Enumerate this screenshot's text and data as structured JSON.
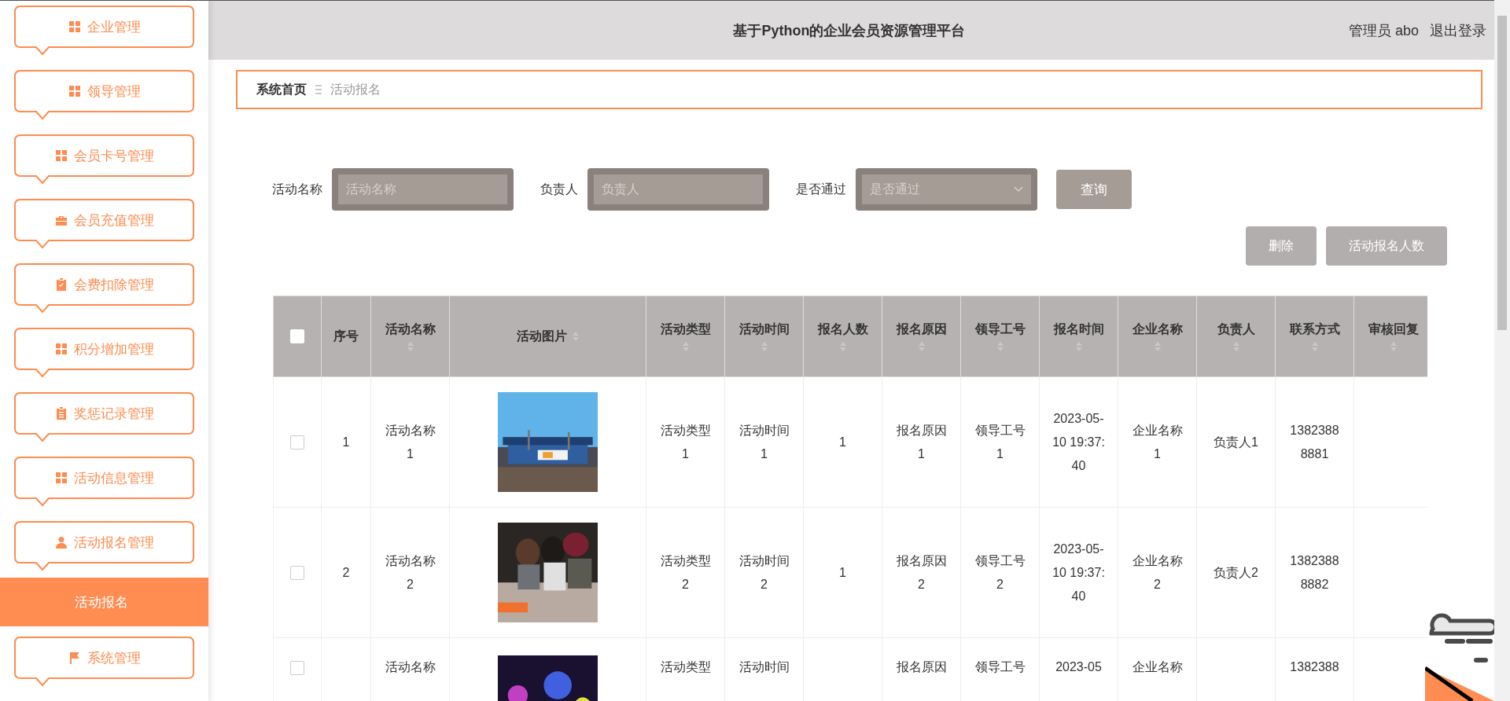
{
  "sidebar": {
    "items": [
      {
        "label": "企业管理",
        "kind": "grid"
      },
      {
        "label": "领导管理",
        "kind": "grid"
      },
      {
        "label": "会员卡号管理",
        "kind": "grid"
      },
      {
        "label": "会员充值管理",
        "kind": "briefcase"
      },
      {
        "label": "会费扣除管理",
        "kind": "clipboard-check"
      },
      {
        "label": "积分增加管理",
        "kind": "grid"
      },
      {
        "label": "奖惩记录管理",
        "kind": "clipboard"
      },
      {
        "label": "活动信息管理",
        "kind": "grid"
      },
      {
        "label": "活动报名管理",
        "kind": "person",
        "children": [
          {
            "label": "活动报名",
            "selected": true
          }
        ]
      },
      {
        "label": "系统管理",
        "kind": "flag"
      }
    ]
  },
  "header": {
    "title": "基于Python的企业会员资源管理平台",
    "user": "管理员 abo",
    "logout": "退出登录"
  },
  "breadcrumb": [
    "系统首页",
    "活动报名"
  ],
  "filters": [
    {
      "kind": "input",
      "label": "活动名称",
      "placeholder": "活动名称"
    },
    {
      "kind": "input",
      "label": "负责人",
      "placeholder": "负责人"
    },
    {
      "kind": "select",
      "label": "是否通过",
      "placeholder": "是否通过"
    }
  ],
  "search_button": "查询",
  "actions": [
    "删除",
    "活动报名人数"
  ],
  "table": {
    "select_all": {
      "checked": false
    },
    "columns": [
      {
        "label": "序号",
        "sortable": false
      },
      {
        "label": "活动名称",
        "sortable": true
      },
      {
        "label": "活动图片",
        "sortable": true
      },
      {
        "label": "活动类型",
        "sortable": true
      },
      {
        "label": "活动时间",
        "sortable": true
      },
      {
        "label": "报名人数",
        "sortable": true
      },
      {
        "label": "报名原因",
        "sortable": true
      },
      {
        "label": "领导工号",
        "sortable": true
      },
      {
        "label": "报名时间",
        "sortable": true
      },
      {
        "label": "企业名称",
        "sortable": true
      },
      {
        "label": "负责人",
        "sortable": true
      },
      {
        "label": "联系方式",
        "sortable": true
      },
      {
        "label": "审核回复",
        "sortable": true
      }
    ],
    "rows": [
      {
        "checked": false,
        "cells": [
          "1",
          "活动名称1",
          {
            "kind": "picture"
          },
          "活动类型1",
          "活动时间1",
          "1",
          "报名原因1",
          "领导工号1",
          "2023-05-10 19:37:40",
          "企业名称1",
          "负责人1",
          "13823888881",
          ""
        ]
      },
      {
        "checked": false,
        "cells": [
          "2",
          "活动名称2",
          {
            "kind": "picture"
          },
          "活动类型2",
          "活动时间2",
          "1",
          "报名原因2",
          "领导工号2",
          "2023-05-10 19:37:40",
          "企业名称2",
          "负责人2",
          "13823888882",
          ""
        ]
      },
      {
        "checked": false,
        "cells": [
          "",
          "活动名称",
          {
            "kind": "picture"
          },
          "活动类型",
          "活动时间",
          "",
          "报名原因",
          "领导工号",
          "2023-05",
          "企业名称",
          "",
          "1382388",
          ""
        ]
      }
    ]
  }
}
